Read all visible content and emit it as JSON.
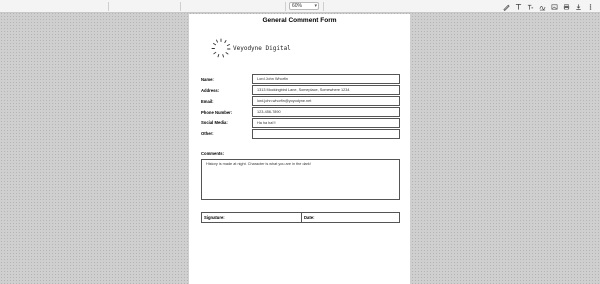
{
  "toolbar": {
    "zoom_value": "60%",
    "icons": [
      "draw-icon",
      "text-icon",
      "text-format-icon",
      "signature-icon",
      "image-icon",
      "print-icon",
      "save-icon",
      "more-icon"
    ]
  },
  "form": {
    "title": "General Comment Form",
    "logo_text": "Veyodyne Digital",
    "fields": [
      {
        "label": "Name:",
        "value": "Lord John Whorfin"
      },
      {
        "label": "Address:",
        "value": "1313 Mockingbird Lane, Someplace, Somewhere 1234"
      },
      {
        "label": "Email:",
        "value": "lord.john.whorfin@yoyodyne.net"
      },
      {
        "label": "Phone Number:",
        "value": "123-456-7890"
      },
      {
        "label": "Social Media:",
        "value": "Ha ha ha!!!"
      },
      {
        "label": "Other:",
        "value": ""
      }
    ],
    "comments_label": "Comments:",
    "comments_value": "History is made at night. Character is what you are in the dark!",
    "signature_label": "Signature:",
    "date_label": "Date:"
  }
}
